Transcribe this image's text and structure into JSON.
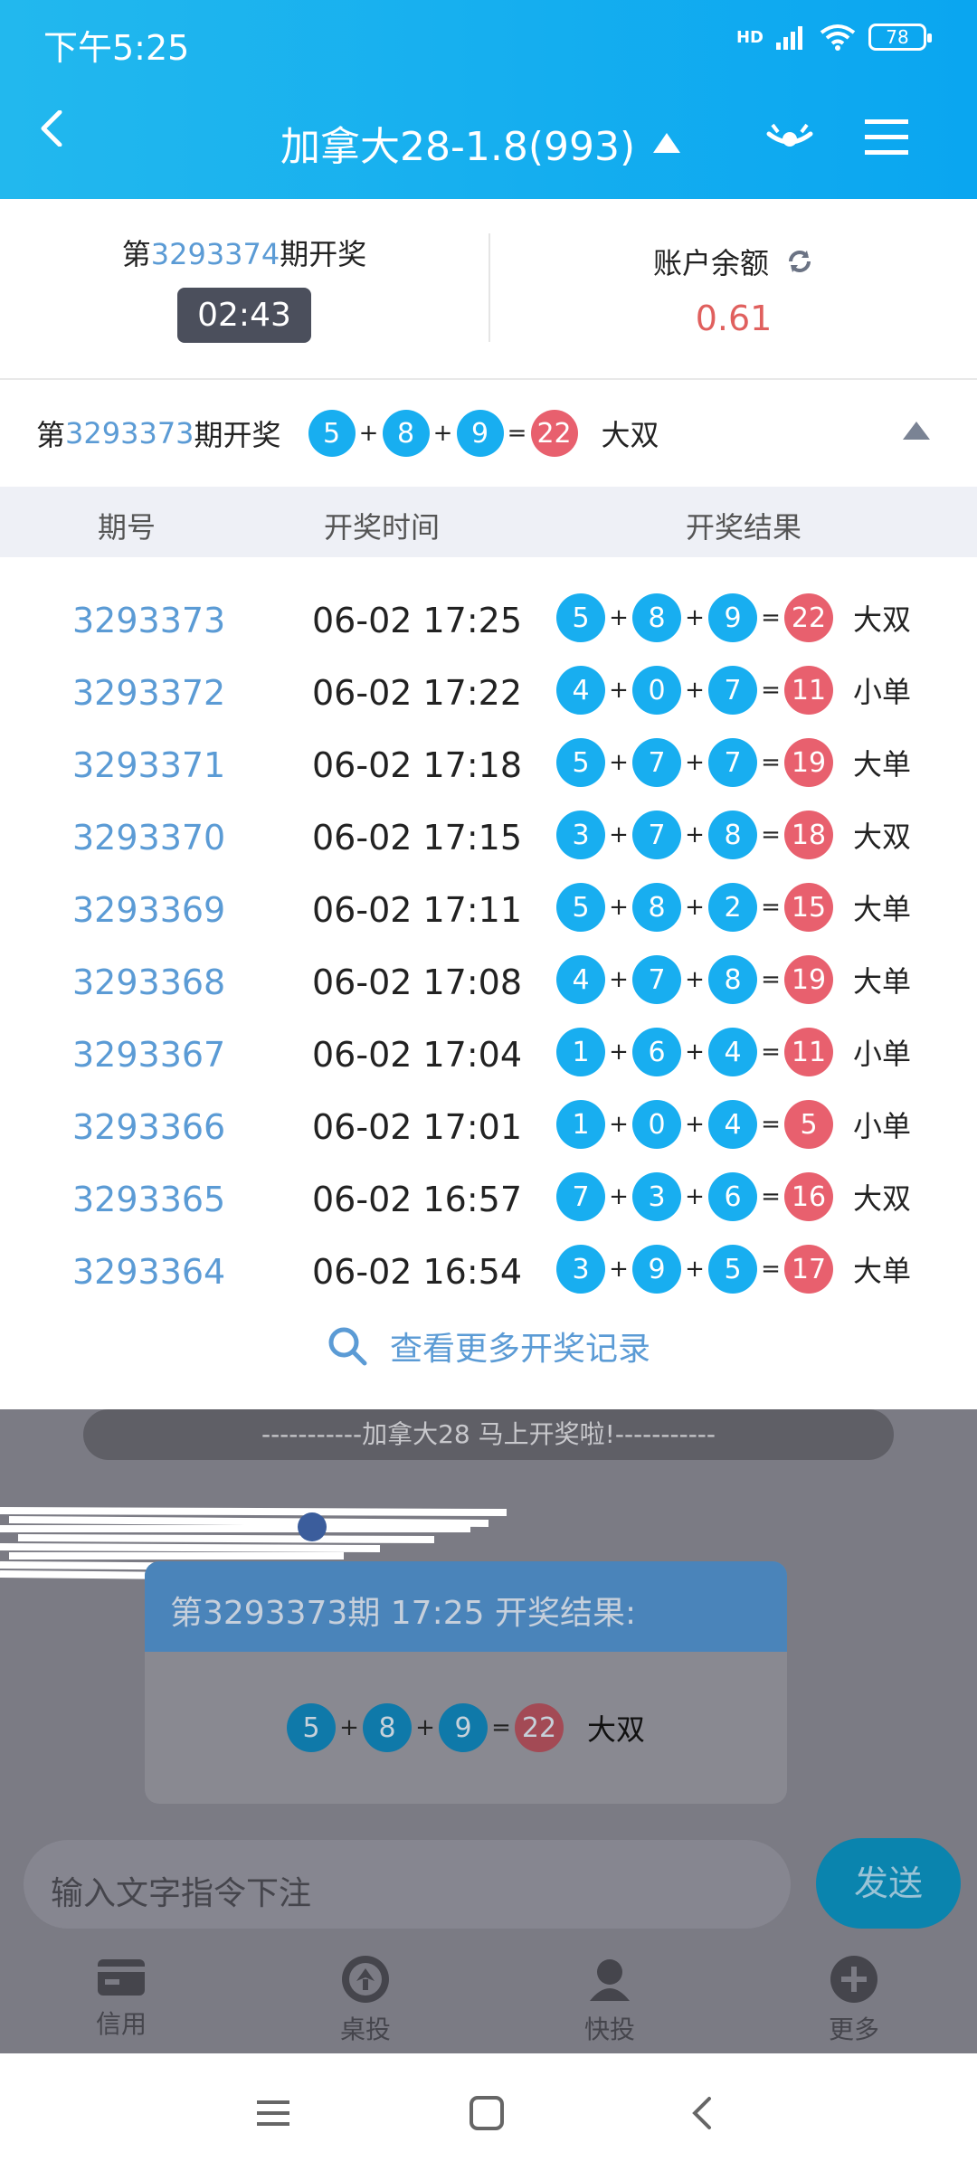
{
  "status_bar": {
    "time": "下午5:25",
    "network": "HD",
    "battery": "78"
  },
  "header": {
    "title": "加拿大28-1.8(993)"
  },
  "draw_info": {
    "prefix": "第",
    "period": "3293374",
    "suffix": "期开奖",
    "countdown": "02:43"
  },
  "balance": {
    "label": "账户余额",
    "value": "0.61"
  },
  "last_result": {
    "prefix": "第",
    "period": "3293373",
    "suffix": "期开奖",
    "balls": [
      "5",
      "8",
      "9"
    ],
    "sum": "22",
    "result": "大双"
  },
  "table": {
    "headers": [
      "期号",
      "开奖时间",
      "开奖结果"
    ],
    "rows": [
      {
        "period": "3293373",
        "time": "06-02 17:25",
        "balls": [
          "5",
          "8",
          "9"
        ],
        "sum": "22",
        "result": "大双"
      },
      {
        "period": "3293372",
        "time": "06-02 17:22",
        "balls": [
          "4",
          "0",
          "7"
        ],
        "sum": "11",
        "result": "小单"
      },
      {
        "period": "3293371",
        "time": "06-02 17:18",
        "balls": [
          "5",
          "7",
          "7"
        ],
        "sum": "19",
        "result": "大单"
      },
      {
        "period": "3293370",
        "time": "06-02 17:15",
        "balls": [
          "3",
          "7",
          "8"
        ],
        "sum": "18",
        "result": "大双"
      },
      {
        "period": "3293369",
        "time": "06-02 17:11",
        "balls": [
          "5",
          "8",
          "2"
        ],
        "sum": "15",
        "result": "大单"
      },
      {
        "period": "3293368",
        "time": "06-02 17:08",
        "balls": [
          "4",
          "7",
          "8"
        ],
        "sum": "19",
        "result": "大单"
      },
      {
        "period": "3293367",
        "time": "06-02 17:04",
        "balls": [
          "1",
          "6",
          "4"
        ],
        "sum": "11",
        "result": "小单"
      },
      {
        "period": "3293366",
        "time": "06-02 17:01",
        "balls": [
          "1",
          "0",
          "4"
        ],
        "sum": "5",
        "result": "小单"
      },
      {
        "period": "3293365",
        "time": "06-02 16:57",
        "balls": [
          "7",
          "3",
          "6"
        ],
        "sum": "16",
        "result": "大双"
      },
      {
        "period": "3293364",
        "time": "06-02 16:54",
        "balls": [
          "3",
          "9",
          "5"
        ],
        "sum": "17",
        "result": "大单"
      }
    ]
  },
  "more_link": "查看更多开奖记录",
  "chat": {
    "notice": "-----------加拿大28 马上开奖啦!-----------",
    "card_title": "第3293373期 17:25 开奖结果:",
    "card_balls": [
      "5",
      "8",
      "9"
    ],
    "card_sum": "22",
    "card_result": "大双"
  },
  "input": {
    "placeholder": "输入文字指令下注",
    "send_label": "发送"
  },
  "tabs": [
    {
      "label": "信用",
      "icon": "card-icon"
    },
    {
      "label": "桌投",
      "icon": "chip-icon"
    },
    {
      "label": "快投",
      "icon": "user-icon"
    },
    {
      "label": "更多",
      "icon": "plus-icon"
    }
  ],
  "colors": {
    "accent": "#18aef0",
    "sum_ball": "#e8606e",
    "link": "#5b9bd5",
    "balance": "#e0605e"
  }
}
